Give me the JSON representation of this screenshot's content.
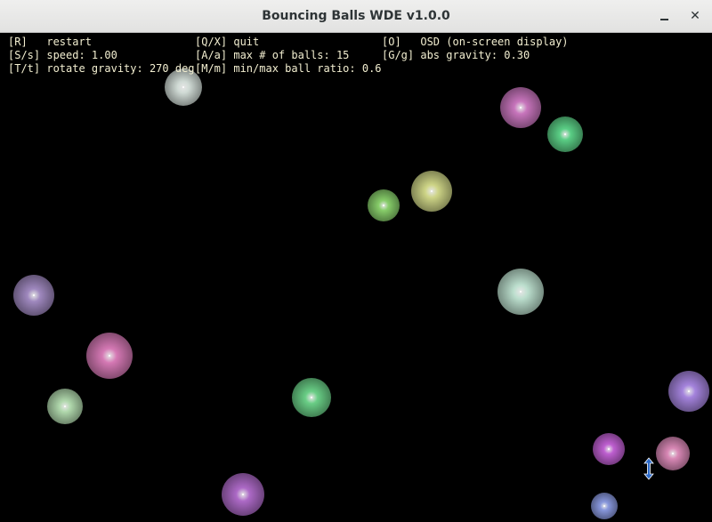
{
  "window": {
    "title": "Bouncing Balls WDE v1.0.0",
    "minimize_icon": "minimize-icon",
    "close_icon": "close-icon",
    "close_glyph": "✕"
  },
  "osd": {
    "rows": [
      [
        "[R]   restart",
        "[Q/X] quit",
        "[O]   OSD (on-screen display)"
      ],
      [
        "[S/s] speed: 1.00",
        "[A/a] max # of balls: 15",
        "[G/g] abs gravity: 0.30"
      ],
      [
        "[T/t] rotate gravity: 270 deg",
        "[M/m] min/max ball ratio: 0.6",
        ""
      ]
    ],
    "text_color": "#f2eed0"
  },
  "balls": [
    {
      "color": "#dbe6e0"
    },
    {
      "color": "#d27bc6"
    },
    {
      "color": "#5fd98c"
    },
    {
      "color": "#d9e08e"
    },
    {
      "color": "#8ed86f"
    },
    {
      "color": "#a78fc8"
    },
    {
      "color": "#c5ead8"
    },
    {
      "color": "#e07fbe"
    },
    {
      "color": "#b9e3b5"
    },
    {
      "color": "#6fd98d"
    },
    {
      "color": "#ad8ae8"
    },
    {
      "color": "#b66fd1"
    },
    {
      "color": "#e48fbf"
    },
    {
      "color": "#c864db"
    },
    {
      "color": "#8f9fe8"
    }
  ],
  "cursor_icon": "resize-vertical-cursor-icon",
  "background_color": "#000000"
}
